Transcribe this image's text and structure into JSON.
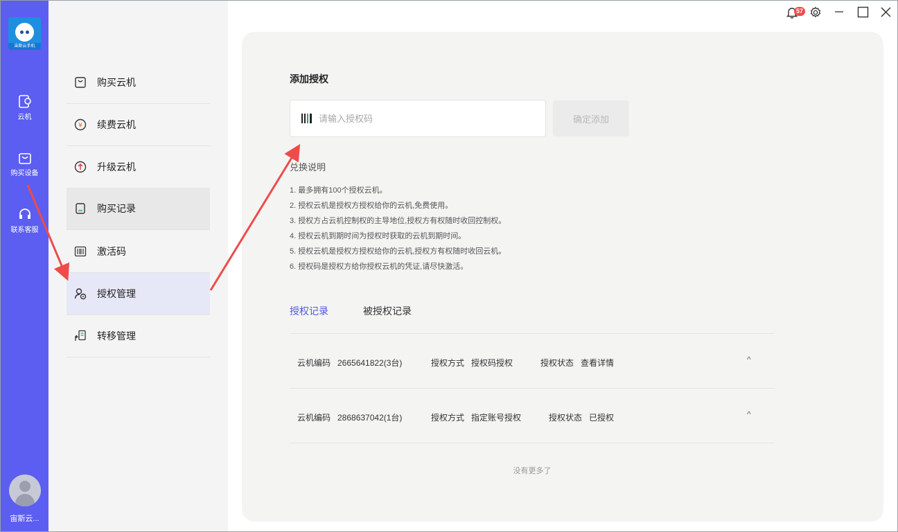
{
  "app": {
    "logo_text": "宙斯云手机",
    "notification_count": "57",
    "user_name": "宙斯云..."
  },
  "rail": {
    "items": [
      {
        "label": "云机",
        "icon": "cloud-phone-icon"
      },
      {
        "label": "购买设备",
        "icon": "shopping-bag-icon"
      },
      {
        "label": "联系客服",
        "icon": "headset-icon"
      }
    ]
  },
  "menu": {
    "items": [
      {
        "label": "购买云机",
        "icon": "shopping-bag-icon"
      },
      {
        "label": "续费云机",
        "icon": "yen-coin-icon"
      },
      {
        "label": "升级云机",
        "icon": "upgrade-arrow-icon"
      },
      {
        "label": "购买记录",
        "icon": "receipt-icon"
      },
      {
        "label": "激活码",
        "icon": "barcode-icon"
      },
      {
        "label": "授权管理",
        "icon": "user-authorize-icon"
      },
      {
        "label": "转移管理",
        "icon": "transfer-icon"
      }
    ]
  },
  "main": {
    "section_title": "添加授权",
    "code_input_placeholder": "请输入授权码",
    "confirm_label": "确定添加",
    "exchange_title": "兑换说明",
    "rules": [
      "1. 最多拥有100个授权云机。",
      "2. 授权云机是授权方授权给你的云机,免费使用。",
      "3. 授权方占云机控制权的主导地位,授权方有权随时收回控制权。",
      "4. 授权云机到期时间为授权时获取的云机到期时间。",
      "5. 授权云机是授权方授权给你的云机,授权方有权随时收回云机。",
      "6. 授权码是授权方给你授权云机的凭证,请尽快激活。"
    ],
    "tabs": [
      "授权记录",
      "被授权记录"
    ],
    "records": [
      {
        "code_label": "云机编码",
        "code_value": "2665641822(3台)",
        "method_label": "授权方式",
        "method_value": "授权码授权",
        "status_label": "授权状态",
        "status_value": "查看详情",
        "chevron": "^"
      },
      {
        "code_label": "云机编码",
        "code_value": "2868637042(1台)",
        "method_label": "授权方式",
        "method_value": "指定账号授权",
        "status_label": "授权状态",
        "status_value": "已授权",
        "chevron": "^"
      }
    ],
    "no_more_text": "没有更多了"
  },
  "colors": {
    "rail_bg": "#5b5ef0",
    "accent": "#5358e6",
    "annotation_arrow": "#ee4b4b"
  }
}
